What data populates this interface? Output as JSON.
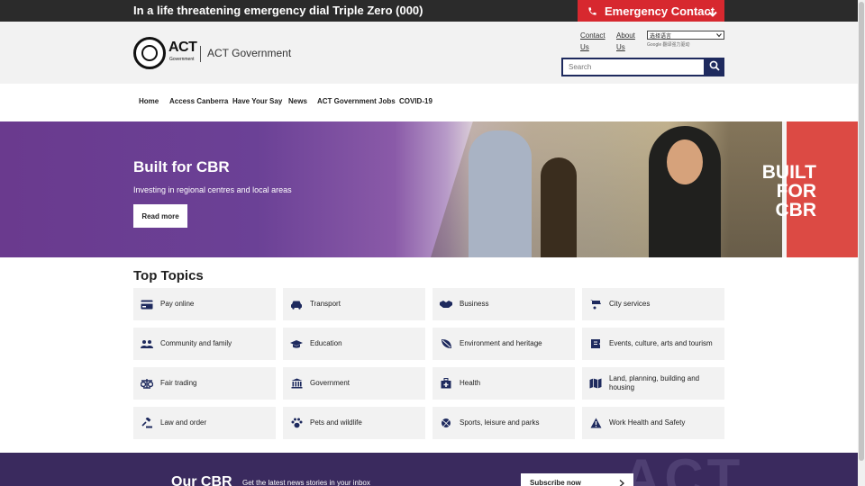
{
  "topbar": {
    "message": "In a life threatening emergency dial Triple Zero (000)",
    "emergency_label": "Emergency Contact"
  },
  "header": {
    "logo_text": "ACT",
    "logo_subtext": "Government",
    "site_title": "ACT Government",
    "links": {
      "contact_line1": "Contact",
      "contact_line2": "Us",
      "about_line1": "About",
      "about_line2": "Us"
    },
    "language_select": "选择语言",
    "google_tag": "Google 翻译强力驱动",
    "search_placeholder": "Search"
  },
  "nav": {
    "items": [
      "Home",
      "Access Canberra",
      "Have Your Say",
      "News",
      "ACT Government Jobs",
      "COVID-19"
    ]
  },
  "hero": {
    "title": "Built for CBR",
    "subtitle": "Investing in regional centres and local areas",
    "button": "Read more",
    "badge_lines": [
      "BUILT",
      "FOR",
      "CBR"
    ]
  },
  "topics": {
    "title": "Top Topics",
    "items": [
      {
        "label": "Pay online",
        "icon": "credit-card-icon"
      },
      {
        "label": "Transport",
        "icon": "car-icon"
      },
      {
        "label": "Business",
        "icon": "handshake-icon"
      },
      {
        "label": "City services",
        "icon": "wheelbarrow-icon"
      },
      {
        "label": "Community and family",
        "icon": "people-icon"
      },
      {
        "label": "Education",
        "icon": "graduation-cap-icon"
      },
      {
        "label": "Environment and heritage",
        "icon": "leaf-icon"
      },
      {
        "label": "Events, culture, arts and tourism",
        "icon": "ticket-icon"
      },
      {
        "label": "Fair trading",
        "icon": "scales-icon"
      },
      {
        "label": "Government",
        "icon": "building-columns-icon"
      },
      {
        "label": "Health",
        "icon": "medical-kit-icon"
      },
      {
        "label": "Land, planning, building and housing",
        "icon": "map-icon"
      },
      {
        "label": "Law and order",
        "icon": "gavel-icon"
      },
      {
        "label": "Pets and wildlife",
        "icon": "paw-icon"
      },
      {
        "label": "Sports, leisure and parks",
        "icon": "ball-icon"
      },
      {
        "label": "Work Health and Safety",
        "icon": "warning-icon"
      }
    ]
  },
  "footer": {
    "title": "Our CBR",
    "subtitle": "Get the latest news stories in your inbox",
    "button": "Subscribe now",
    "decor_text": "ACT"
  },
  "colors": {
    "emergency_red": "#d7282f",
    "navy": "#1e2a5e",
    "hero_purple": "#6a3a8e",
    "badge_red": "#dc4a44",
    "footer_purple": "#3a2a5e"
  }
}
